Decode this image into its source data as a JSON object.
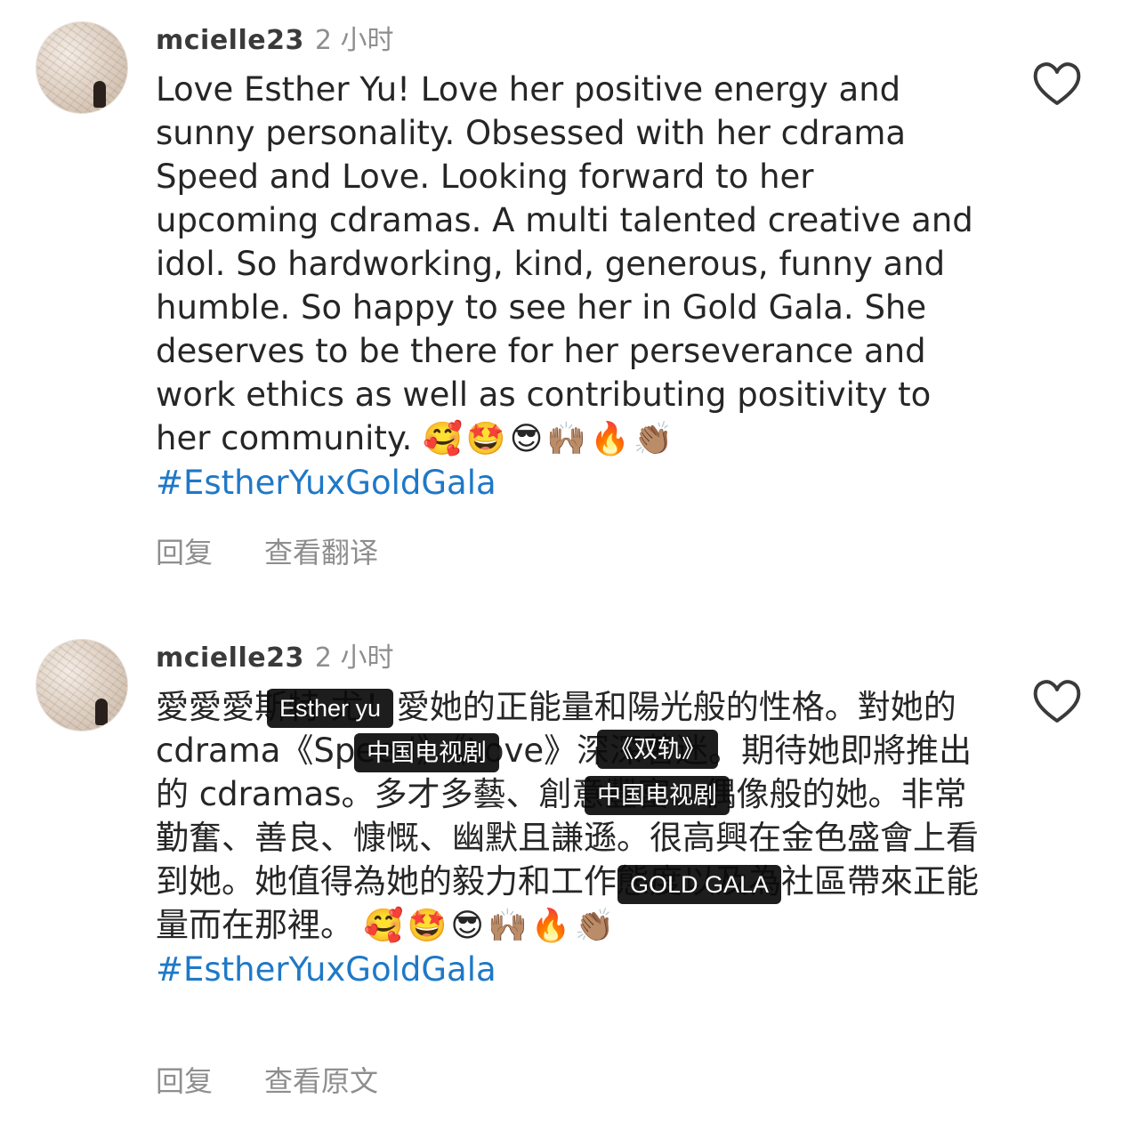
{
  "comments": [
    {
      "username": "mcielle23",
      "timestamp": "2 小时",
      "text": "Love Esther Yu! Love her positive energy and sunny personality. Obsessed with her cdrama Speed and Love. Looking forward to her upcoming cdramas. A multi talented creative and idol. So hardworking, kind, generous, funny and humble. So happy to see her in Gold Gala. She deserves to be there for her perseverance and work ethics as well as contributing positivity to her community.",
      "emojis": "🥰🤩😎🙌🏽🔥👏🏽",
      "hashtag": "#EstherYuxGoldGala",
      "actions": {
        "reply": "回复",
        "translate": "查看翻译"
      },
      "like_icon": "heart-outline-icon"
    },
    {
      "username": "mcielle23",
      "timestamp": "2 小时",
      "text": "愛愛愛斯特·尤！愛她的正能量和陽光般的性格。對她的 cdrama《Speed》《Love》深深著迷。期待她即將推出的 cdramas。多才多藝、創意豐富、偶像般的她。非常勤奮、善良、慷慨、幽默且謙遜。很高興在金色盛會上看到她。她值得為她的毅力和工作態度以及為社區帶來正能量而在那裡。",
      "emojis": "🥰🤩😎🙌🏽🔥👏🏽",
      "hashtag": "#EstherYuxGoldGala",
      "actions": {
        "reply": "回复",
        "original": "查看原文"
      },
      "like_icon": "heart-outline-icon",
      "tag_overlays": [
        "Esther yu",
        "中国电视剧",
        "《双轨》",
        "中国电视剧",
        "GOLD GALA"
      ]
    }
  ]
}
